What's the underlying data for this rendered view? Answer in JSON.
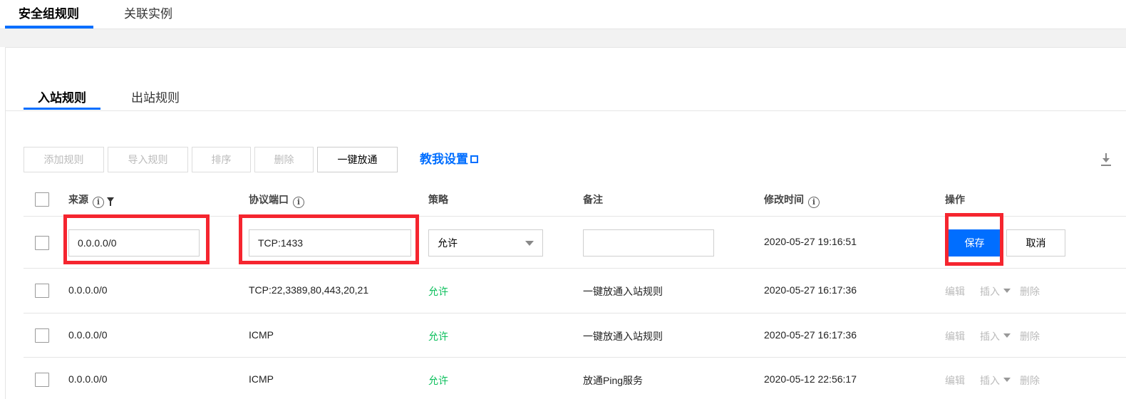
{
  "top_tabs": [
    {
      "label": "安全组规则",
      "active": true
    },
    {
      "label": "关联实例",
      "active": false
    }
  ],
  "inner_tabs": [
    {
      "label": "入站规则",
      "active": true
    },
    {
      "label": "出站规则",
      "active": false
    }
  ],
  "toolbar": {
    "add_rule": "添加规则",
    "import_rule": "导入规则",
    "sort": "排序",
    "delete": "删除",
    "one_click_allow": "一键放通",
    "help_link": "教我设置"
  },
  "table": {
    "headers": {
      "source": "来源",
      "protocol_port": "协议端口",
      "policy": "策略",
      "remark": "备注",
      "modified_time": "修改时间",
      "actions": "操作"
    },
    "edit_row": {
      "source": "0.0.0.0/0",
      "protocol_port": "TCP:1433",
      "policy": "允许",
      "remark": "",
      "modified_time": "2020-05-27 19:16:51",
      "save": "保存",
      "cancel": "取消"
    },
    "rows": [
      {
        "source": "0.0.0.0/0",
        "protocol_port": "TCP:22,3389,80,443,20,21",
        "policy": "允许",
        "remark": "一键放通入站规则",
        "modified_time": "2020-05-27 16:17:36"
      },
      {
        "source": "0.0.0.0/0",
        "protocol_port": "ICMP",
        "policy": "允许",
        "remark": "一键放通入站规则",
        "modified_time": "2020-05-27 16:17:36"
      },
      {
        "source": "0.0.0.0/0",
        "protocol_port": "ICMP",
        "policy": "允许",
        "remark": "放通Ping服务",
        "modified_time": "2020-05-12 22:56:17"
      }
    ],
    "row_actions": {
      "edit": "编辑",
      "insert": "插入",
      "delete": "删除"
    }
  },
  "colors": {
    "accent": "#006eff",
    "allow": "#0abf5b",
    "highlight": "#f5252f"
  },
  "icons": {
    "info": "info-circle-icon",
    "filter": "filter-icon",
    "external_link": "external-link-icon",
    "download": "download-icon",
    "caret": "chevron-down-icon"
  }
}
